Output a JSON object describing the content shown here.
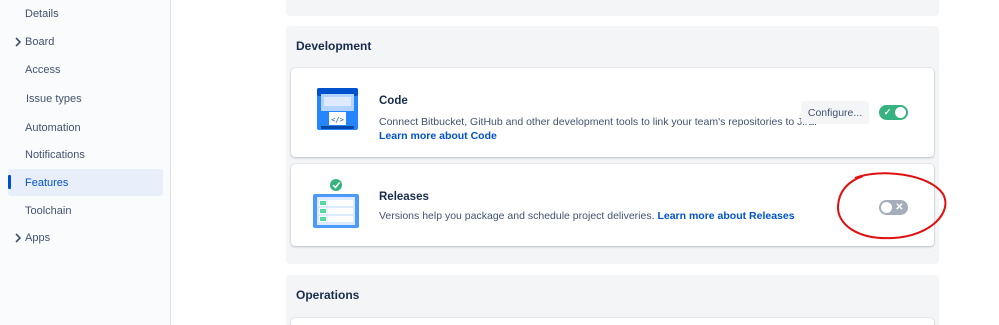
{
  "sidebar": {
    "items": [
      {
        "label": "Details",
        "expandable": false,
        "active": false
      },
      {
        "label": "Board",
        "expandable": true,
        "active": false
      },
      {
        "label": "Access",
        "expandable": false,
        "active": false
      },
      {
        "label": "Issue types",
        "expandable": false,
        "active": false
      },
      {
        "label": "Automation",
        "expandable": false,
        "active": false
      },
      {
        "label": "Notifications",
        "expandable": false,
        "active": false
      },
      {
        "label": "Features",
        "expandable": false,
        "active": true
      },
      {
        "label": "Toolchain",
        "expandable": false,
        "active": false
      },
      {
        "label": "Apps",
        "expandable": true,
        "active": false
      }
    ]
  },
  "development": {
    "title": "Development",
    "code": {
      "title": "Code",
      "description": "Connect Bitbucket, GitHub and other development tools to link your team's repositories to Jira.",
      "link": "Learn more about Code",
      "configure_label": "Configure...",
      "enabled": true,
      "icon": "code-repository-icon"
    },
    "releases": {
      "title": "Releases",
      "description": "Versions help you package and schedule project deliveries.",
      "link": "Learn more about Releases",
      "enabled": false,
      "icon": "releases-icon"
    }
  },
  "operations": {
    "title": "Operations"
  },
  "colors": {
    "accent": "#0052cc",
    "toggle_on": "#36b37e",
    "toggle_off": "#a5adba",
    "annotation": "#e01010"
  }
}
